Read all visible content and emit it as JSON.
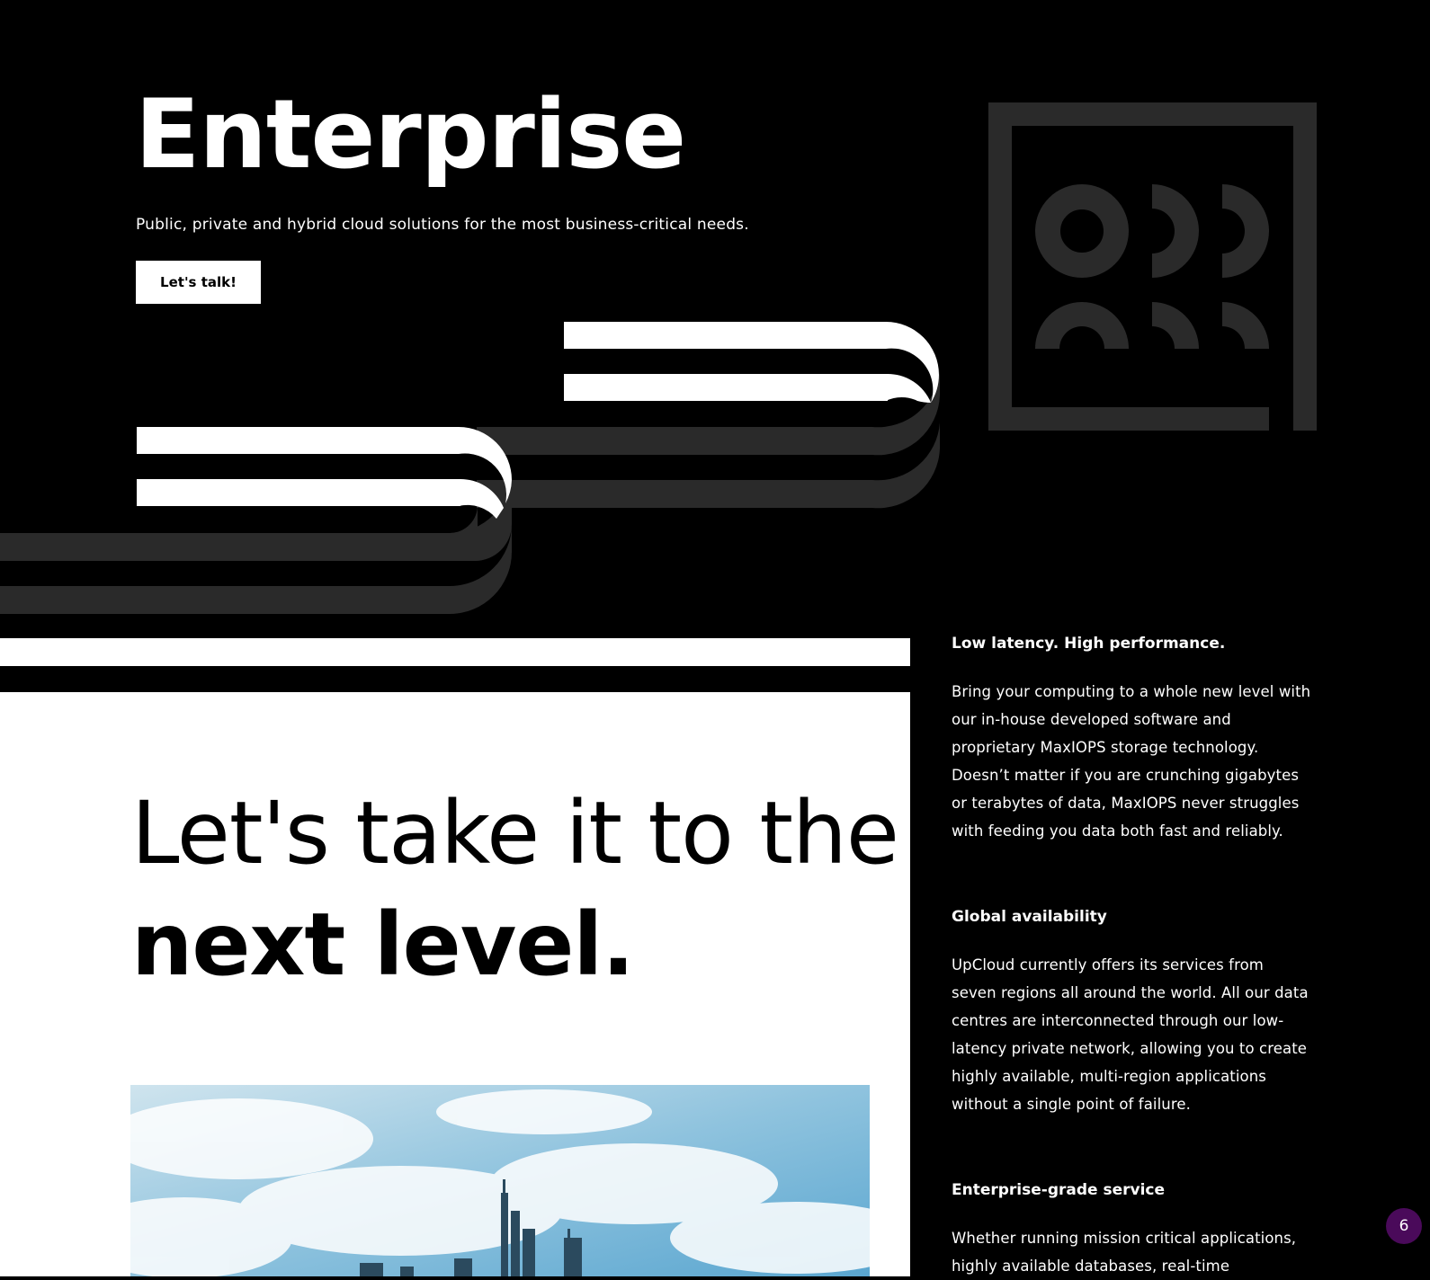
{
  "hero": {
    "title": "Enterprise",
    "subtitle": "Public, private and hybrid cloud solutions for the most business-critical needs.",
    "cta_label": "Let's talk!"
  },
  "tagline": {
    "line1": "Let's take it to the",
    "line2": "next level."
  },
  "features": [
    {
      "title": "Low latency. High performance.",
      "body": "Bring your computing to a whole new level with our in-house developed software and proprietary MaxIOPS storage technology. Doesn’t matter if you are crunching gigabytes or terabytes of data, MaxIOPS never struggles with feeding you data both fast and reliably."
    },
    {
      "title": "Global availability",
      "body": "UpCloud currently offers its services from seven regions all around the world. All our data centres are interconnected through our low-latency private network, allowing you to create highly available, multi-region applications without a single point of failure."
    },
    {
      "title": "Enterprise-grade service",
      "body": "Whether running mission critical applications, highly available databases, real-time"
    }
  ],
  "badge": {
    "count": "6"
  },
  "colors": {
    "background": "#000000",
    "foreground": "#ffffff",
    "stripe_gray": "#2a2a2a",
    "badge": "#4a0a5a"
  },
  "icons": {
    "hero_art": "stripes-graphic",
    "logo_mark": "circles-square-icon",
    "photo": "city-skyline-image"
  }
}
